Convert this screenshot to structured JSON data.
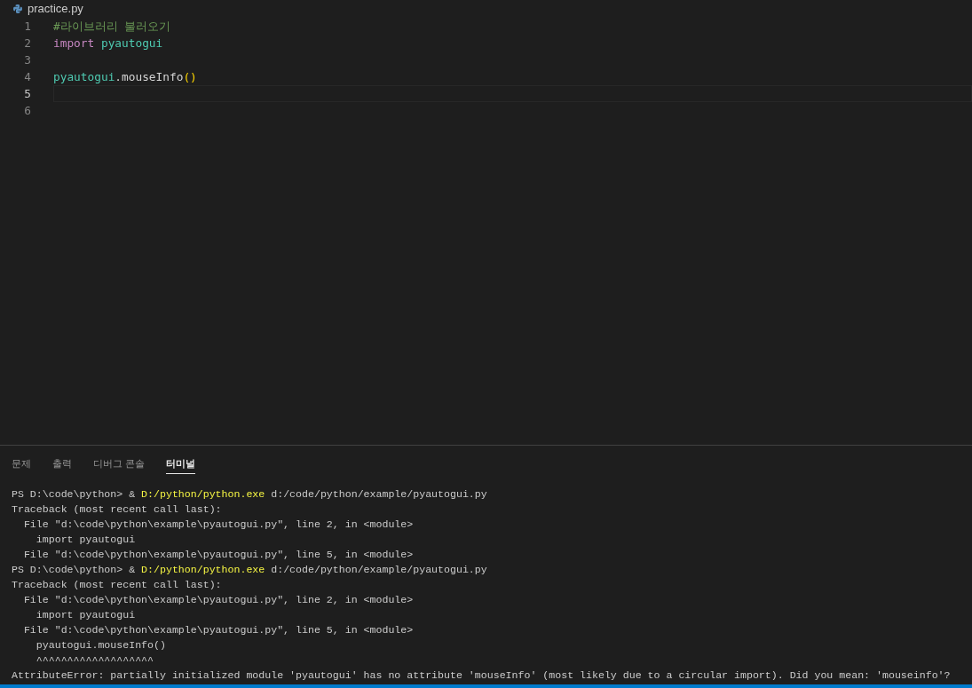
{
  "editor_tab": {
    "title": "practice.py"
  },
  "code_lines": [
    {
      "number": "1",
      "current": false,
      "tokens": [
        {
          "kind": "comment",
          "text": "#라이브러리 불러오기"
        }
      ]
    },
    {
      "number": "2",
      "current": false,
      "tokens": [
        {
          "kind": "keyword",
          "text": "import "
        },
        {
          "kind": "module",
          "text": "pyautogui"
        }
      ]
    },
    {
      "number": "3",
      "current": false
    },
    {
      "number": "4",
      "current": false,
      "tokens": [
        {
          "kind": "module",
          "text": "pyautogui"
        },
        {
          "kind": "plain",
          "text": ".mouseInfo"
        },
        {
          "kind": "bracket",
          "text": "()"
        }
      ]
    },
    {
      "number": "5",
      "current": true
    },
    {
      "number": "6",
      "current": false
    }
  ],
  "panel_tabs": [
    {
      "label": "문제",
      "selected": false
    },
    {
      "label": "출력",
      "selected": false
    },
    {
      "label": "디버그 콘솔",
      "selected": false
    },
    {
      "label": "터미널",
      "selected": true
    }
  ],
  "terminal_lines": [
    [
      {
        "kind": "plain",
        "text": "PS D:\\code\\python> & "
      },
      {
        "kind": "exe",
        "text": "D:/python/python.exe"
      },
      {
        "kind": "plain",
        "text": " d:/code/python/example/pyautogui.py"
      }
    ],
    [
      {
        "kind": "plain",
        "text": "Traceback (most recent call last):"
      }
    ],
    [
      {
        "kind": "plain",
        "text": "  File \"d:\\code\\python\\example\\pyautogui.py\", line 2, in <module>"
      }
    ],
    [
      {
        "kind": "plain",
        "text": "    import pyautogui"
      }
    ],
    [
      {
        "kind": "plain",
        "text": "  File \"d:\\code\\python\\example\\pyautogui.py\", line 5, in <module>"
      }
    ],
    [
      {
        "kind": "plain",
        "text": "PS D:\\code\\python> & "
      },
      {
        "kind": "exe",
        "text": "D:/python/python.exe"
      },
      {
        "kind": "plain",
        "text": " d:/code/python/example/pyautogui.py"
      }
    ],
    [
      {
        "kind": "plain",
        "text": "Traceback (most recent call last):"
      }
    ],
    [
      {
        "kind": "plain",
        "text": "  File \"d:\\code\\python\\example\\pyautogui.py\", line 2, in <module>"
      }
    ],
    [
      {
        "kind": "plain",
        "text": "    import pyautogui"
      }
    ],
    [
      {
        "kind": "plain",
        "text": "  File \"d:\\code\\python\\example\\pyautogui.py\", line 5, in <module>"
      }
    ],
    [
      {
        "kind": "plain",
        "text": "    pyautogui.mouseInfo()"
      }
    ],
    [
      {
        "kind": "plain",
        "text": "    ^^^^^^^^^^^^^^^^^^^"
      }
    ],
    [
      {
        "kind": "plain",
        "text": "AttributeError: partially initialized module 'pyautogui' has no attribute 'mouseInfo' (most likely due to a circular import). Did you mean: 'mouseinfo'?"
      }
    ]
  ]
}
